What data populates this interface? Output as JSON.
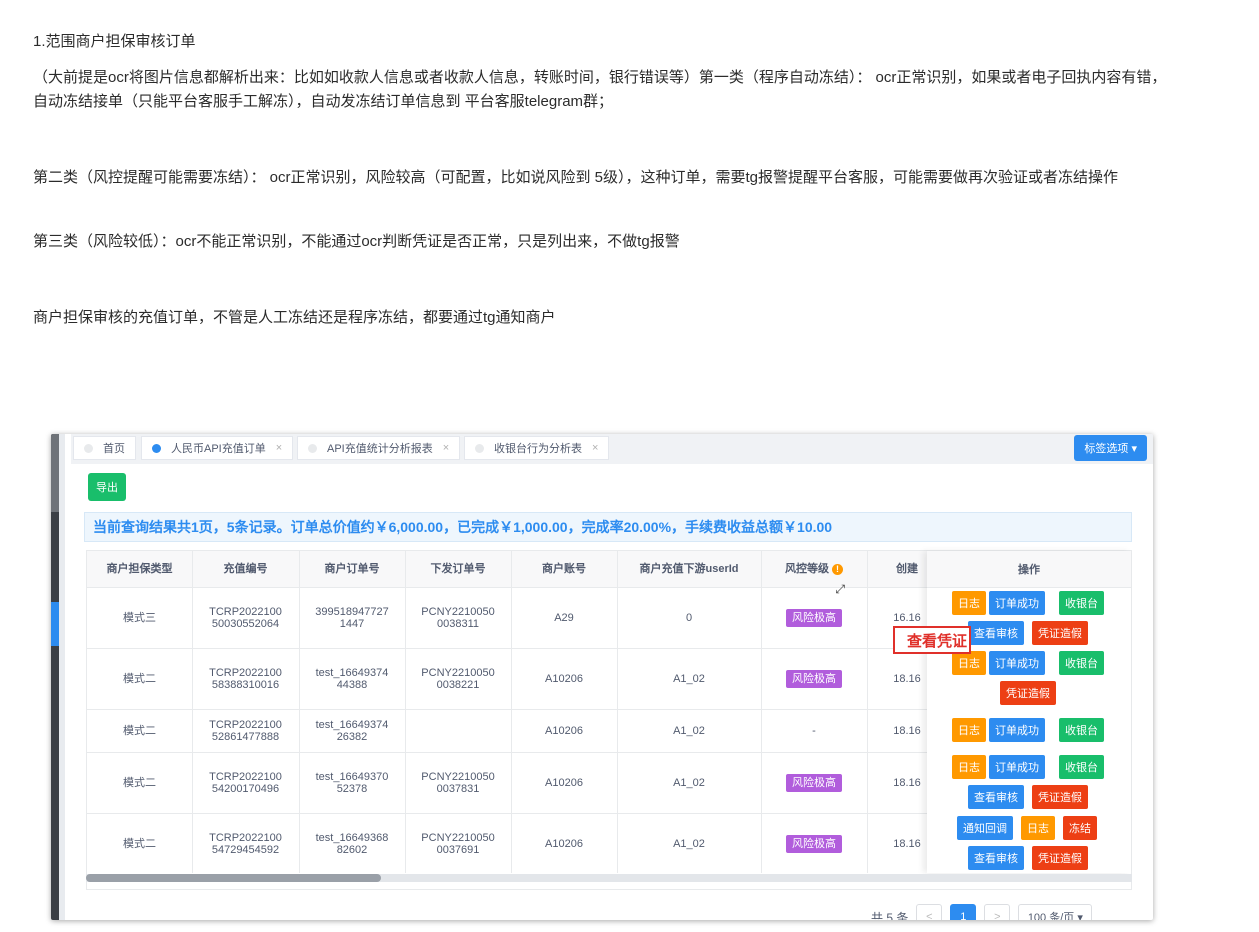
{
  "doc": {
    "p1": "1.范围商户担保审核订单",
    "p2": "（大前提是ocr将图片信息都解析出来：比如如收款人信息或者收款人信息，转账时间，银行错误等）第一类（程序自动冻结）： ocr正常识别，如果或者电子回执内容有错， 自动冻结接单（只能平台客服手工解冻），自动发冻结订单信息到 平台客服telegram群；",
    "p3": "第二类（风控提醒可能需要冻结）： ocr正常识别，风险较高（可配置，比如说风险到 5级），这种订单，需要tg报警提醒平台客服，可能需要做再次验证或者冻结操作",
    "p4": "第三类（风险较低）：ocr不能正常识别，不能通过ocr判断凭证是否正常，只是列出来，不做tg报警",
    "p5": "商户担保审核的充值订单，不管是人工冻结还是程序冻结，都要通过tg通知商户"
  },
  "tabs": [
    {
      "label": "首页",
      "active": false,
      "closable": false
    },
    {
      "label": "人民币API充值订单",
      "active": true,
      "closable": true
    },
    {
      "label": "API充值统计分析报表",
      "active": false,
      "closable": true
    },
    {
      "label": "收银台行为分析表",
      "active": false,
      "closable": true
    }
  ],
  "tab_options_label": "标签选项 ▾",
  "export_label": "导出",
  "summary": "当前查询结果共1页，5条记录。订单总价值约￥6,000.00，已完成￥1,000.00，完成率20.00%，手续费收益总额￥10.00",
  "table": {
    "headers": [
      "商户担保类型",
      "充值编号",
      "商户订单号",
      "下发订单号",
      "商户账号",
      "商户充值下游userId",
      "风控等级",
      "创建",
      "操作"
    ],
    "rows": [
      {
        "type": "模式三",
        "recharge_no": "TCRP2022100\n50030552064",
        "merchant_order": "399518947727\n1447",
        "payout_order": "PCNY2210050\n0038311",
        "account": "A29",
        "user_id": "0",
        "risk": "风险极高",
        "created": "16.16"
      },
      {
        "type": "模式二",
        "recharge_no": "TCRP2022100\n58388310016",
        "merchant_order": "test_16649374\n44388",
        "payout_order": "PCNY2210050\n0038221",
        "account": "A10206",
        "user_id": "A1_02",
        "risk": "风险极高",
        "created": "18.16"
      },
      {
        "type": "模式二",
        "recharge_no": "TCRP2022100\n52861477888",
        "merchant_order": "test_16649374\n26382",
        "payout_order": "",
        "account": "A10206",
        "user_id": "A1_02",
        "risk": "-",
        "created": "18.16"
      },
      {
        "type": "模式二",
        "recharge_no": "TCRP2022100\n54200170496",
        "merchant_order": "test_16649370\n52378",
        "payout_order": "PCNY2210050\n0037831",
        "account": "A10206",
        "user_id": "A1_02",
        "risk": "风险极高",
        "created": "18.16"
      },
      {
        "type": "模式二",
        "recharge_no": "TCRP2022100\n54729454592",
        "merchant_order": "test_16649368\n82602",
        "payout_order": "PCNY2210050\n0037691",
        "account": "A10206",
        "user_id": "A1_02",
        "risk": "风险极高",
        "created": "18.16"
      }
    ],
    "ops": {
      "log": "日志",
      "order_success": "订单成功",
      "cashier": "收银台",
      "view_review": "查看审核",
      "fake_voucher": "凭证造假",
      "notify_callback": "通知回调",
      "freeze": "冻结"
    }
  },
  "callout": "查看凭证",
  "pager": {
    "total": "共 5 条",
    "prev": "<",
    "current": "1",
    "next": ">",
    "page_size": "100 条/页 ▾"
  },
  "colors": {
    "primary": "#2d8cf0",
    "success": "#19be6b",
    "warning": "#ff9900",
    "danger": "#ed3f14",
    "risk": "#b15ddc"
  }
}
